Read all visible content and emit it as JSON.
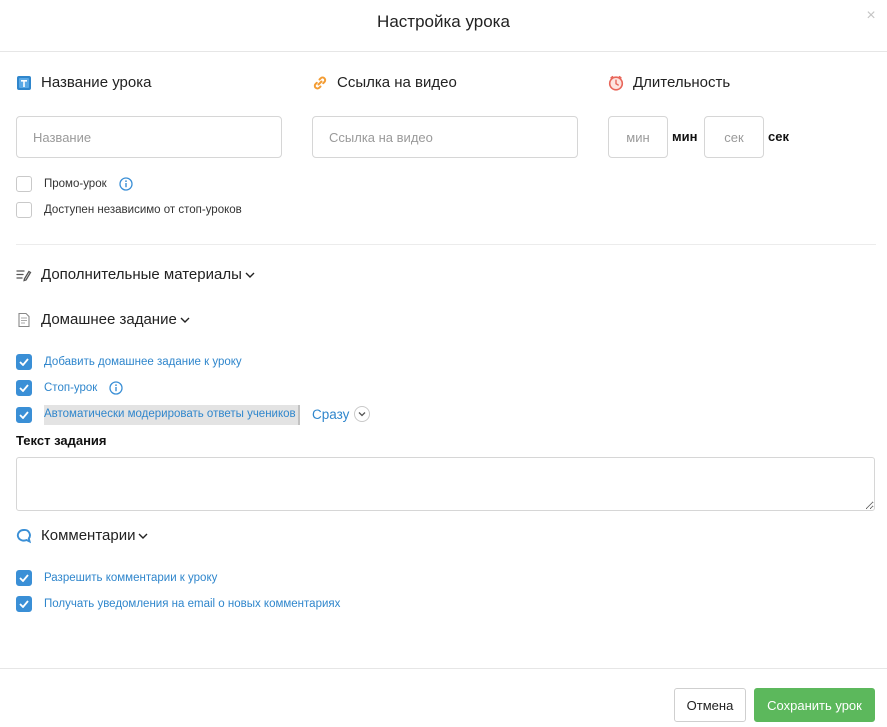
{
  "modal": {
    "title": "Настройка урока",
    "close_glyph": "×"
  },
  "lesson_name": {
    "title": "Название урока",
    "icon": "title-icon",
    "placeholder": "Название",
    "value": ""
  },
  "video_link": {
    "title": "Ссылка на видео",
    "icon": "link-icon",
    "placeholder": "Ссылка на видео",
    "value": ""
  },
  "duration": {
    "title": "Длительность",
    "icon": "clock-icon",
    "minutes_placeholder": "мин",
    "minutes_unit": "мин",
    "seconds_placeholder": "сек",
    "seconds_unit": "сек"
  },
  "lesson_options": [
    {
      "label": "Промо-урок",
      "checked": false,
      "info": true
    },
    {
      "label": "Доступен независимо от стоп-уроков",
      "checked": false,
      "info": false
    }
  ],
  "extra_materials": {
    "title": "Дополнительные материалы",
    "icon": "materials-icon",
    "chevron": "˅"
  },
  "homework": {
    "title": "Домашнее задание",
    "icon": "document-icon",
    "chevron": "˅",
    "options": [
      {
        "label": "Добавить домашнее задание к уроку",
        "checked": true,
        "info": false
      },
      {
        "label": "Стоп-урок",
        "checked": true,
        "info": true
      },
      {
        "label": "Автоматически модерировать ответы учеников",
        "checked": true,
        "info": false
      }
    ],
    "moderation_timing": "Сразу",
    "task_text_label": "Текст задания",
    "task_text_value": ""
  },
  "comments": {
    "title": "Комментарии",
    "icon": "comment-icon",
    "chevron": "˅",
    "options": [
      {
        "label": "Разрешить комментарии к уроку",
        "checked": true
      },
      {
        "label": "Получать уведомления на email о новых комментариях",
        "checked": true
      }
    ]
  },
  "footer": {
    "cancel_label": "Отмена",
    "save_label": "Сохранить урок"
  },
  "colors": {
    "accent_blue": "#3a8fd6",
    "link_blue": "#2f86cc",
    "link_orange": "#f39c33",
    "clock_red": "#e8665a",
    "save_green": "#5cb85c"
  }
}
